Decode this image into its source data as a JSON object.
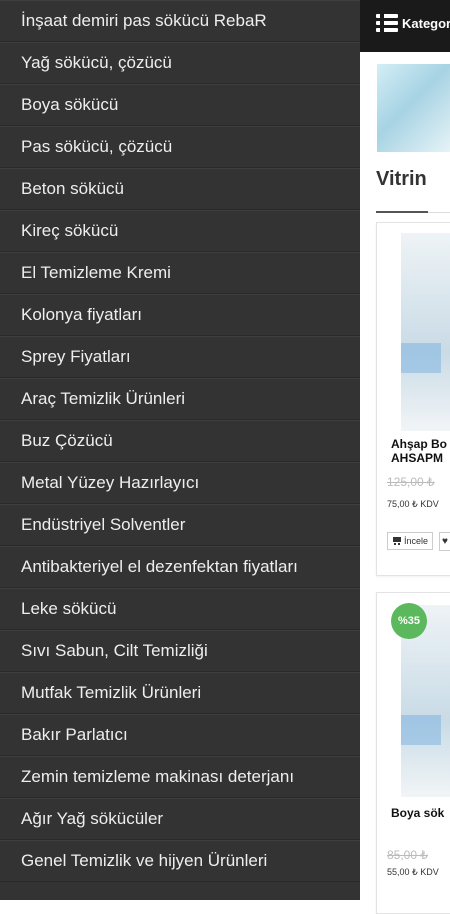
{
  "header": {
    "menu_label": "Kategoriler"
  },
  "section": {
    "title": "Vitrin"
  },
  "products": [
    {
      "name": "Ahşap Bo",
      "name_line2": "AHSAPM",
      "old_price": "125,00 ₺",
      "new_price": "75,00 ₺ KDV",
      "view_label": "İncele",
      "fav_icon": "heart-icon"
    },
    {
      "name": "Boya sök",
      "discount": "%35",
      "old_price": "85,00 ₺",
      "new_price": "55,00 ₺ KDV"
    }
  ],
  "drawer": {
    "items": [
      "İnşaat demiri pas sökücü RebaR",
      "Yağ sökücü, çözücü",
      "Boya sökücü",
      "Pas sökücü, çözücü",
      "Beton sökücü",
      "Kireç sökücü",
      "El Temizleme Kremi",
      "Kolonya fiyatları",
      "Sprey Fiyatları",
      "Araç Temizlik Ürünleri",
      "Buz Çözücü",
      "Metal Yüzey Hazırlayıcı",
      "Endüstriyel Solventler",
      "Antibakteriyel el dezenfektan fiyatları",
      "Leke sökücü",
      "Sıvı Sabun, Cilt Temizliği",
      "Mutfak Temizlik Ürünleri",
      "Bakır Parlatıcı",
      "Zemin temizleme makinası deterjanı",
      "Ağır Yağ sökücüler",
      "Genel Temizlik ve hijyen Ürünleri"
    ]
  },
  "colors": {
    "drawer_bg": "#333333",
    "topbar_bg": "#1a1a1a",
    "discount_bg": "#5cb85c"
  }
}
